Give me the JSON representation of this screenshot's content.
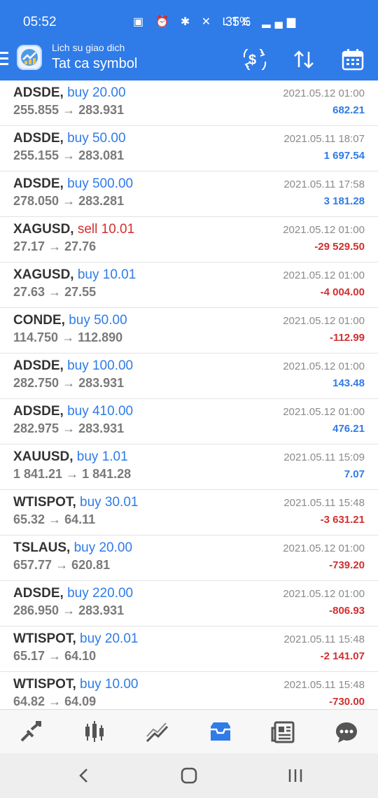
{
  "status": {
    "time": "05:52",
    "battery": "35%",
    "icons": "▣ ⏰ ✱ ✕ LTE ▂▄▆"
  },
  "header": {
    "subtitle": "Lich su giao dich",
    "title": "Tat ca symbol"
  },
  "trades": [
    {
      "symbol": "ADSDE,",
      "action": "buy 20.00",
      "type": "buy",
      "from": "255.855",
      "to": "283.931",
      "date": "2021.05.12 01:00",
      "profit": "682.21",
      "sign": "pos"
    },
    {
      "symbol": "ADSDE,",
      "action": "buy 50.00",
      "type": "buy",
      "from": "255.155",
      "to": "283.081",
      "date": "2021.05.11 18:07",
      "profit": "1 697.54",
      "sign": "pos"
    },
    {
      "symbol": "ADSDE,",
      "action": "buy 500.00",
      "type": "buy",
      "from": "278.050",
      "to": "283.281",
      "date": "2021.05.11 17:58",
      "profit": "3 181.28",
      "sign": "pos"
    },
    {
      "symbol": "XAGUSD,",
      "action": "sell 10.01",
      "type": "sell",
      "from": "27.17",
      "to": "27.76",
      "date": "2021.05.12 01:00",
      "profit": "-29 529.50",
      "sign": "neg"
    },
    {
      "symbol": "XAGUSD,",
      "action": "buy 10.01",
      "type": "buy",
      "from": "27.63",
      "to": "27.55",
      "date": "2021.05.12 01:00",
      "profit": "-4 004.00",
      "sign": "neg"
    },
    {
      "symbol": "CONDE,",
      "action": "buy 50.00",
      "type": "buy",
      "from": "114.750",
      "to": "112.890",
      "date": "2021.05.12 01:00",
      "profit": "-112.99",
      "sign": "neg"
    },
    {
      "symbol": "ADSDE,",
      "action": "buy 100.00",
      "type": "buy",
      "from": "282.750",
      "to": "283.931",
      "date": "2021.05.12 01:00",
      "profit": "143.48",
      "sign": "pos"
    },
    {
      "symbol": "ADSDE,",
      "action": "buy 410.00",
      "type": "buy",
      "from": "282.975",
      "to": "283.931",
      "date": "2021.05.12 01:00",
      "profit": "476.21",
      "sign": "pos"
    },
    {
      "symbol": "XAUUSD,",
      "action": "buy 1.01",
      "type": "buy",
      "from": "1 841.21",
      "to": "1 841.28",
      "date": "2021.05.11 15:09",
      "profit": "7.07",
      "sign": "pos"
    },
    {
      "symbol": "WTISPOT,",
      "action": "buy 30.01",
      "type": "buy",
      "from": "65.32",
      "to": "64.11",
      "date": "2021.05.11 15:48",
      "profit": "-3 631.21",
      "sign": "neg"
    },
    {
      "symbol": "TSLAUS,",
      "action": "buy 20.00",
      "type": "buy",
      "from": "657.77",
      "to": "620.81",
      "date": "2021.05.12 01:00",
      "profit": "-739.20",
      "sign": "neg"
    },
    {
      "symbol": "ADSDE,",
      "action": "buy 220.00",
      "type": "buy",
      "from": "286.950",
      "to": "283.931",
      "date": "2021.05.12 01:00",
      "profit": "-806.93",
      "sign": "neg"
    },
    {
      "symbol": "WTISPOT,",
      "action": "buy 20.01",
      "type": "buy",
      "from": "65.17",
      "to": "64.10",
      "date": "2021.05.11 15:48",
      "profit": "-2 141.07",
      "sign": "neg"
    },
    {
      "symbol": "WTISPOT,",
      "action": "buy 10.00",
      "type": "buy",
      "from": "64.82",
      "to": "64.09",
      "date": "2021.05.11 15:48",
      "profit": "-730.00",
      "sign": "neg"
    }
  ],
  "arrow": "→",
  "nav": [
    "trade-icon",
    "chart-icon",
    "analytics-icon",
    "history-icon",
    "news-icon",
    "chat-icon"
  ],
  "colors": {
    "accent": "#2f7be8",
    "buy": "#2f7be8",
    "sell": "#d32f2f"
  }
}
